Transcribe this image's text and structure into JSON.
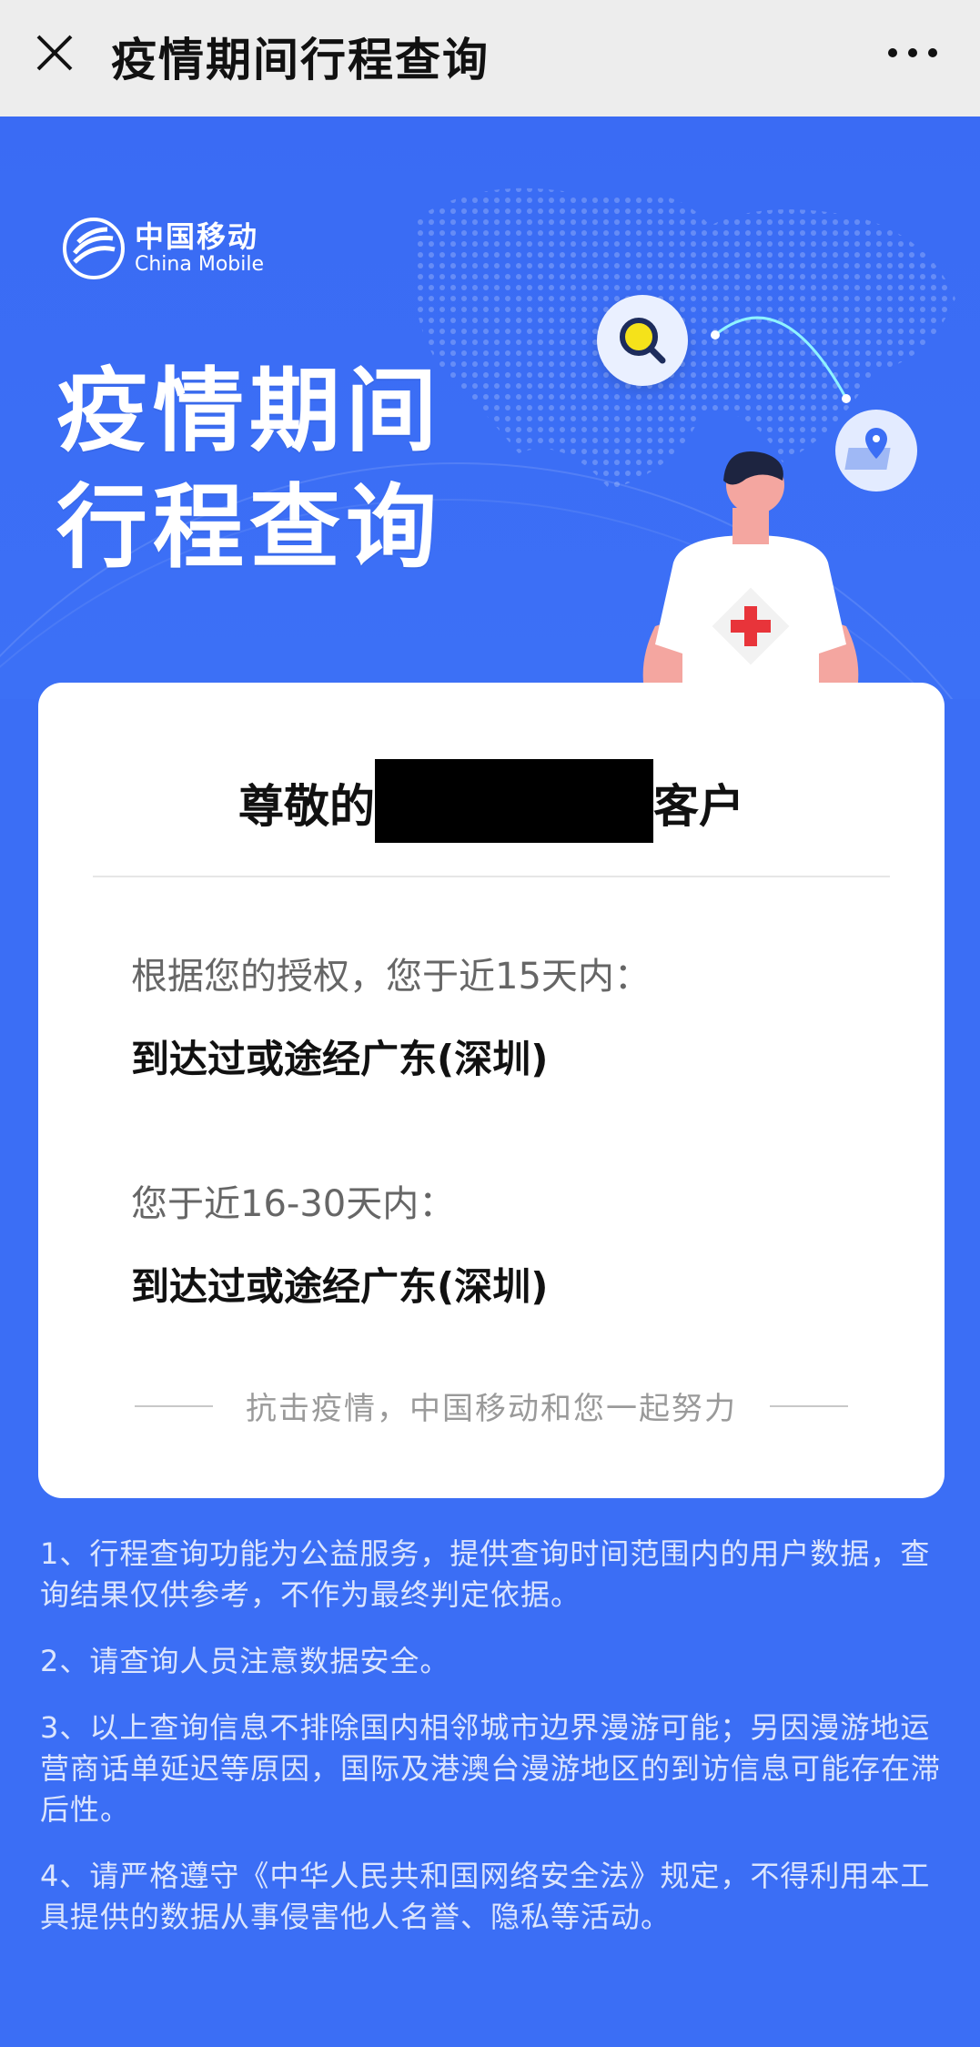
{
  "nav": {
    "title": "疫情期间行程查询",
    "close_icon": "close-icon",
    "more_icon": "more-icon"
  },
  "hero": {
    "brand_cn": "中国移动",
    "brand_en": "China Mobile",
    "title_line1": "疫情期间",
    "title_line2": "行程查询"
  },
  "card": {
    "greeting_prefix": "尊敬的",
    "greeting_suffix": "客户",
    "section1_label": "根据您的授权，您于近15天内：",
    "section1_value": "到达过或途经广东(深圳)",
    "section2_label": "您于近16-30天内：",
    "section2_value": "到达过或途经广东(深圳)",
    "slogan": "抗击疫情，中国移动和您一起努力"
  },
  "notes": [
    "1、行程查询功能为公益服务，提供查询时间范围内的用户数据，查询结果仅供参考，不作为最终判定依据。",
    "2、请查询人员注意数据安全。",
    "3、以上查询信息不排除国内相邻城市边界漫游可能；另因漫游地运营商话单延迟等原因，国际及港澳台漫游地区的到访信息可能存在滞后性。",
    "4、请严格遵守《中华人民共和国网络安全法》规定，不得利用本工具提供的数据从事侵害他人名誉、隐私等活动。"
  ],
  "colors": {
    "background": "#3b6ef5",
    "card": "#ffffff",
    "topbar": "#ededed",
    "accent_red": "#e8343a"
  }
}
